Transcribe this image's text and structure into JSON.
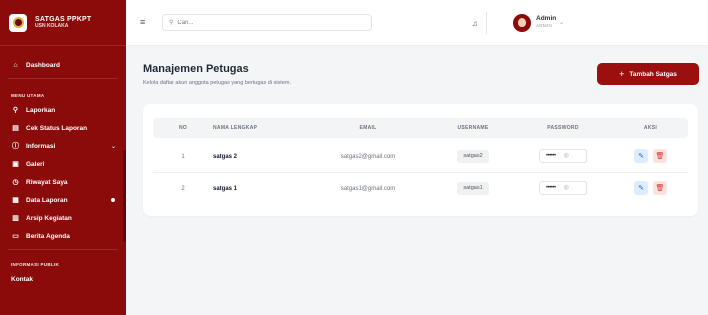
{
  "brand": {
    "title": "SATGAS PPKPT",
    "subtitle": "USN KOLAKA"
  },
  "sidebar": {
    "dashboard": "Dashboard",
    "section_main": "MENU UTAMA",
    "items": [
      {
        "label": "Laporkan",
        "icon": "pin-icon"
      },
      {
        "label": "Cek Status Laporan",
        "icon": "document-icon"
      },
      {
        "label": "Informasi",
        "icon": "info-icon"
      },
      {
        "label": "Galeri",
        "icon": "gallery-icon"
      },
      {
        "label": "Riwayat Saya",
        "icon": "history-icon"
      },
      {
        "label": "Data Laporan",
        "icon": "file-icon"
      },
      {
        "label": "Arsip Kegiatan",
        "icon": "archive-icon"
      },
      {
        "label": "Berita Agenda",
        "icon": "news-icon"
      }
    ],
    "section_public": "INFORMASI PUBLIK",
    "public_items": [
      {
        "label": "Kontak"
      }
    ]
  },
  "header": {
    "search_placeholder": "Cari...",
    "user_name": "Admin",
    "user_role": "ADMIN"
  },
  "page": {
    "title": "Manajemen Petugas",
    "subtitle": "Kelola daftar akun anggota petugas yang bertugas di sistem.",
    "add_button": "Tambah Satgas"
  },
  "table": {
    "headers": [
      "NO",
      "NAMA LENGKAP",
      "EMAIL",
      "USERNAME",
      "PASSWORD",
      "AKSI"
    ],
    "rows": [
      {
        "no": "1",
        "name": "satgas 2",
        "email": "satgas2@gmail.com",
        "username": "satgas2",
        "password": "••••••"
      },
      {
        "no": "2",
        "name": "satgas 1",
        "email": "satgas1@gmail.com",
        "username": "satgas1",
        "password": "••••••"
      }
    ]
  },
  "colors": {
    "primary": "#8b0b0b",
    "button": "#9b0f0f",
    "edit": "#2563eb",
    "delete": "#dc2626"
  }
}
